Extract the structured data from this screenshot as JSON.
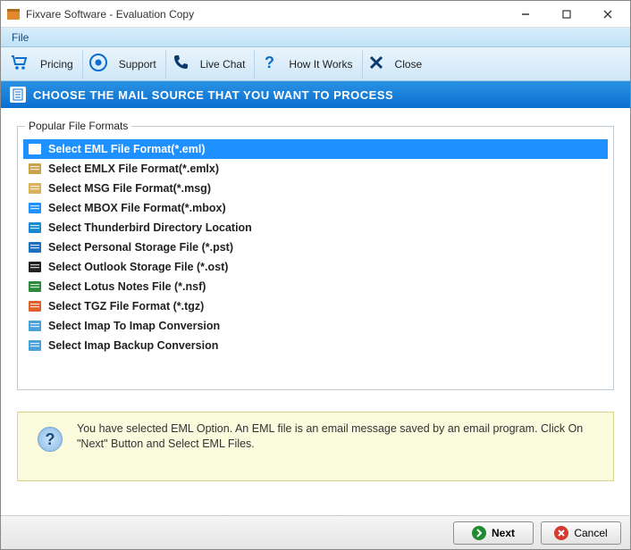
{
  "window": {
    "title": "Fixvare Software - Evaluation Copy"
  },
  "menubar": {
    "file": "File"
  },
  "toolbar": {
    "pricing": "Pricing",
    "support": "Support",
    "livechat": "Live Chat",
    "howitworks": "How It Works",
    "close": "Close"
  },
  "section": {
    "title": "CHOOSE THE MAIL SOURCE THAT YOU WANT TO PROCESS"
  },
  "formats": {
    "legend": "Popular File Formats",
    "items": [
      {
        "label": "Select EML File Format(*.eml)",
        "icon": "file-eml",
        "selected": true
      },
      {
        "label": "Select EMLX File Format(*.emlx)",
        "icon": "mail",
        "selected": false
      },
      {
        "label": "Select MSG File Format(*.msg)",
        "icon": "file-msg",
        "selected": false
      },
      {
        "label": "Select MBOX File Format(*.mbox)",
        "icon": "file-mbox",
        "selected": false
      },
      {
        "label": "Select Thunderbird Directory Location",
        "icon": "thunderbird",
        "selected": false
      },
      {
        "label": "Select Personal Storage File (*.pst)",
        "icon": "outlook",
        "selected": false
      },
      {
        "label": "Select Outlook Storage File (*.ost)",
        "icon": "outlook-dark",
        "selected": false
      },
      {
        "label": "Select Lotus Notes File (*.nsf)",
        "icon": "lotus",
        "selected": false
      },
      {
        "label": "Select TGZ File Format (*.tgz)",
        "icon": "tgz",
        "selected": false
      },
      {
        "label": "Select Imap To Imap Conversion",
        "icon": "imap",
        "selected": false
      },
      {
        "label": "Select Imap Backup Conversion",
        "icon": "imap-backup",
        "selected": false
      }
    ]
  },
  "info": {
    "text": "You have selected EML Option. An EML file is an email message saved by an email program. Click On \"Next\" Button and Select EML Files."
  },
  "footer": {
    "next": "Next",
    "cancel": "Cancel"
  }
}
